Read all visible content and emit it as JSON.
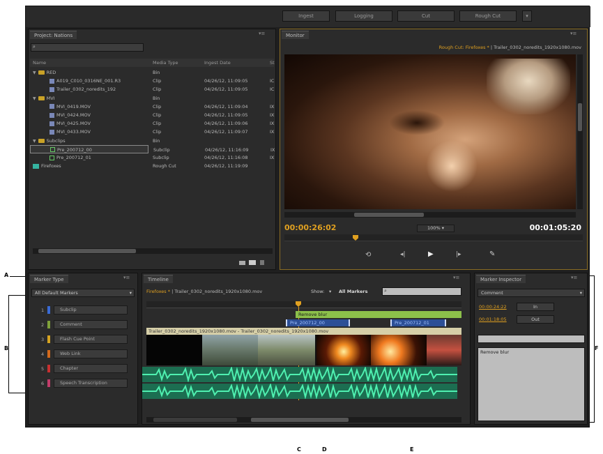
{
  "workspace_buttons": [
    "Ingest",
    "Logging",
    "Cut",
    "Rough Cut"
  ],
  "project": {
    "tab": "Project: Nations",
    "search_placeholder": "",
    "columns": [
      "Name",
      "Media Type",
      "Ingest Date",
      "St"
    ],
    "rows": [
      {
        "indent": 0,
        "kind": "folder",
        "name": "RED",
        "type": "Bin",
        "date": "",
        "extra": ""
      },
      {
        "indent": 1,
        "kind": "clip",
        "name": "A019_C010_0316NE_001.R3",
        "type": "Clip",
        "date": "04/26/12, 11:09:05",
        "extra": "IC"
      },
      {
        "indent": 1,
        "kind": "clip",
        "name": "Trailer_0302_noredits_192",
        "type": "Clip",
        "date": "04/26/12, 11:09:05",
        "extra": "IC"
      },
      {
        "indent": 0,
        "kind": "folder",
        "name": "MVI",
        "type": "Bin",
        "date": "",
        "extra": ""
      },
      {
        "indent": 1,
        "kind": "clip",
        "name": "MVI_0419.MOV",
        "type": "Clip",
        "date": "04/26/12, 11:09:04",
        "extra": "IX"
      },
      {
        "indent": 1,
        "kind": "clip",
        "name": "MVI_0424.MOV",
        "type": "Clip",
        "date": "04/26/12, 11:09:05",
        "extra": "IX"
      },
      {
        "indent": 1,
        "kind": "clip",
        "name": "MVI_0425.MOV",
        "type": "Clip",
        "date": "04/26/12, 11:09:06",
        "extra": "IX"
      },
      {
        "indent": 1,
        "kind": "clip",
        "name": "MVI_0433.MOV",
        "type": "Clip",
        "date": "04/26/12, 11:09:07",
        "extra": "IX"
      },
      {
        "indent": 0,
        "kind": "folder",
        "name": "Subclips",
        "type": "Bin",
        "date": "",
        "extra": ""
      },
      {
        "indent": 1,
        "kind": "subclip",
        "name": "Pre_200712_00",
        "type": "Subclip",
        "date": "04/26/12, 11:16:09",
        "extra": "IX"
      },
      {
        "indent": 1,
        "kind": "subclip",
        "name": "Pre_200712_01",
        "type": "Subclip",
        "date": "04/26/12, 11:16:08",
        "extra": "IX"
      },
      {
        "indent": 0,
        "kind": "rough",
        "name": "Firefoxes",
        "type": "Rough Cut",
        "date": "04/26/12, 11:19:09",
        "extra": ""
      }
    ]
  },
  "monitor": {
    "tab": "Monitor",
    "title_highlight": "Rough Cut: Firefoxes *",
    "title_rest": "| Trailer_0302_noredits_1920x1080.mov",
    "current_time": "00:00:26:02",
    "zoom": "100%",
    "duration": "00:01:05:20"
  },
  "marker_type": {
    "tab": "Marker Type",
    "dropdown": "All Default Markers",
    "items": [
      {
        "num": "1",
        "label": "Subclip",
        "color": "#3a6bd6"
      },
      {
        "num": "2",
        "label": "Comment",
        "color": "#7fa13a"
      },
      {
        "num": "3",
        "label": "Flash Cue Point",
        "color": "#d7a421"
      },
      {
        "num": "4",
        "label": "Web Link",
        "color": "#d46a1c"
      },
      {
        "num": "5",
        "label": "Chapter",
        "color": "#c73030"
      },
      {
        "num": "6",
        "label": "Speech Transcription",
        "color": "#c23c6a"
      }
    ]
  },
  "timeline": {
    "tab": "Timeline",
    "title_highlight": "Firefoxes *",
    "title_rest": "| Trailer_0302_noredits_1920x1080.mov",
    "show_label": "Show:",
    "show_value": "All Markers",
    "comment_marker": "Remove blur",
    "subclip1": "Pre_200712_00",
    "subclip2": "Pre_200712_01",
    "track_label": "Trailer_0302_noredits_1920x1080.mov - Trailer_0302_noredits_1920x1080.mov"
  },
  "inspector": {
    "tab": "Marker Inspector",
    "type": "Comment",
    "in_time": "00:00:24:22",
    "in_label": "In",
    "out_time": "00:01:18:05",
    "out_label": "Out",
    "name_value": "",
    "comment": "Remove blur"
  },
  "callouts": {
    "A": "A",
    "B": "B",
    "C": "C",
    "D": "D",
    "E": "E",
    "F": "F"
  },
  "colors": {
    "accent": "#e0a020",
    "audio": "#37d09c",
    "comment_marker": "#8cc04a",
    "subclip_marker": "#3a6bd6"
  }
}
